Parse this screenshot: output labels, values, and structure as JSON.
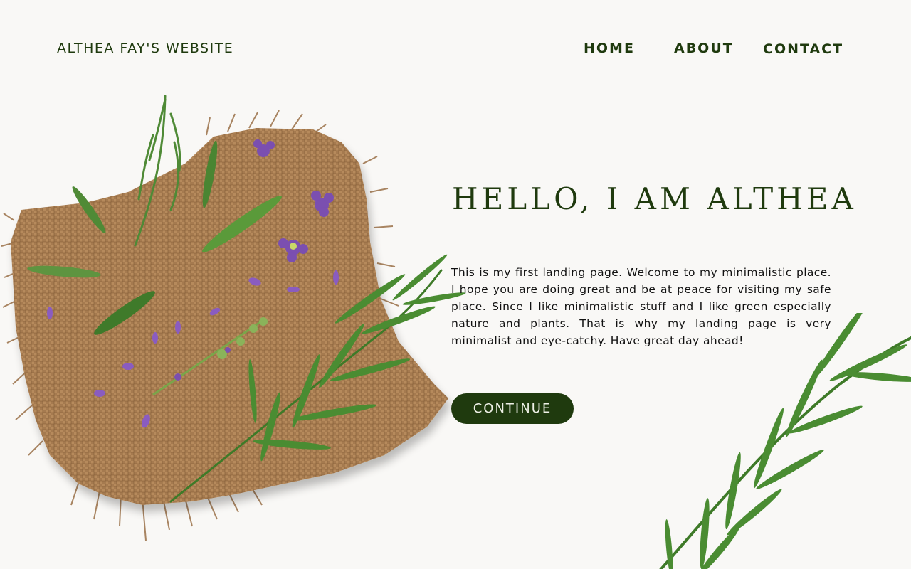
{
  "header": {
    "site_title": "ALTHEA FAY'S WEBSITE",
    "nav": {
      "home": "HOME",
      "about": "ABOUT",
      "contact": "CONTACT"
    }
  },
  "hero": {
    "heading": "HELLO, I AM ALTHEA",
    "body": "This is my first landing page. Welcome to my minimalistic place. I hope you are doing great and be at peace for visiting my safe place. Since I like minimalistic stuff and I like green especially nature and plants. That is why my landing page is very minimalist and eye-catchy. Have great day ahead!",
    "button_label": "CONTINUE"
  },
  "images": {
    "hero": "burlap-cloth-with-rosemary-and-lavender",
    "corner": "rosemary-sprig"
  },
  "colors": {
    "background": "#f9f8f6",
    "primary": "#1f3a0e",
    "text": "#111111",
    "burlap": "#a57a4f",
    "lavender": "#7b4fb0",
    "leaf": "#4f8a36"
  }
}
